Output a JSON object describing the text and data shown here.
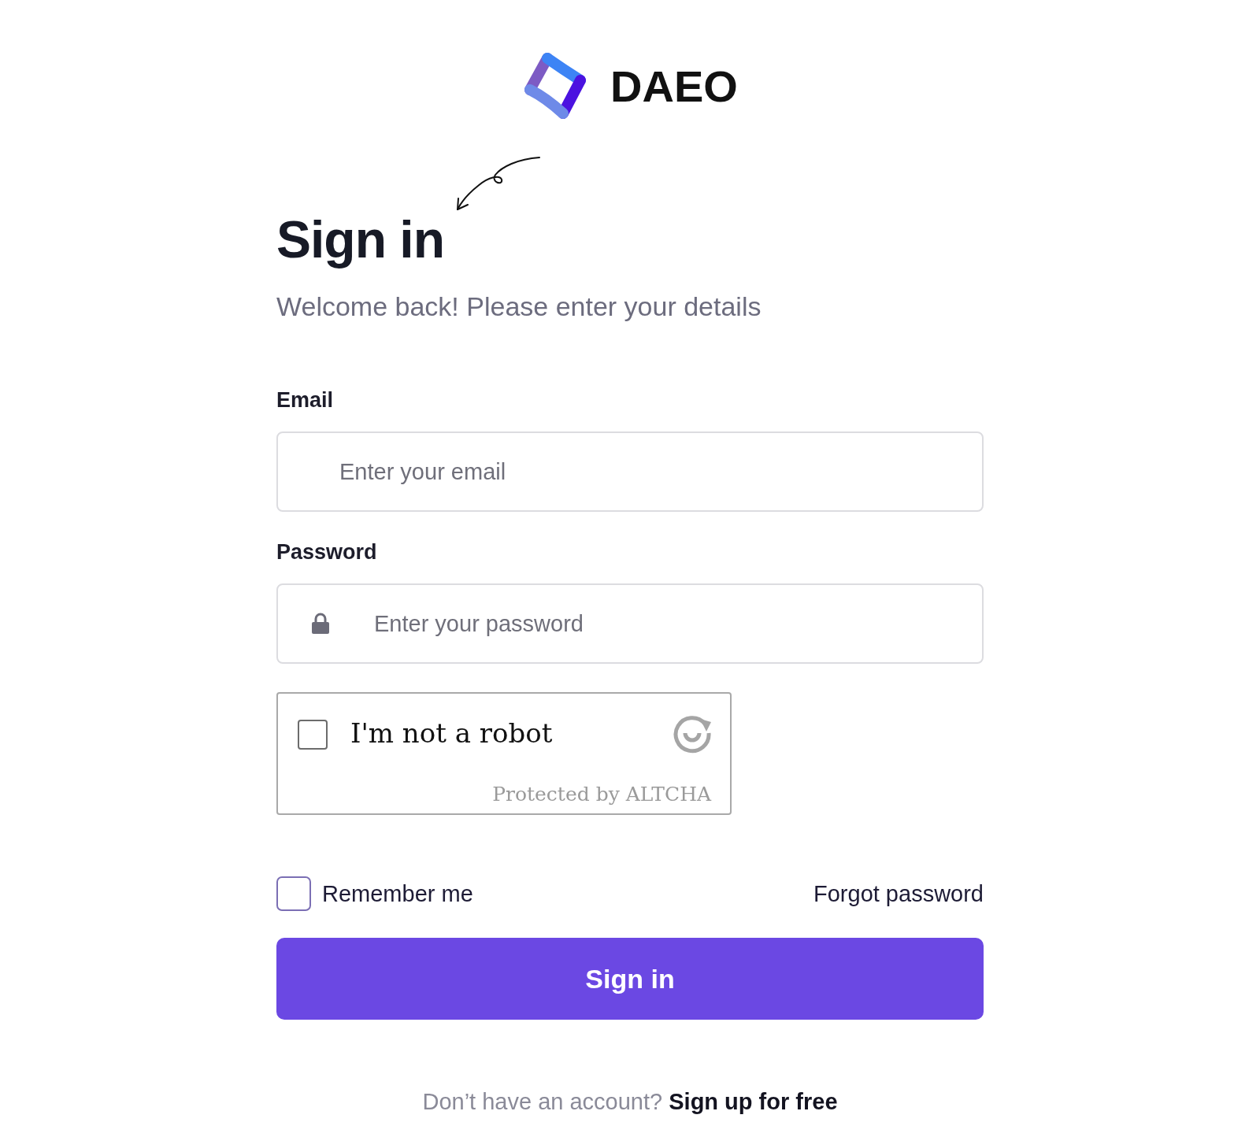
{
  "brand": {
    "name": "DAEO"
  },
  "heading": "Sign in",
  "subtitle": "Welcome back! Please enter your details",
  "fields": [
    {
      "kind": "email",
      "label": "Email",
      "placeholder": "Enter your email"
    },
    {
      "kind": "password",
      "label": "Password",
      "placeholder": "Enter your password"
    }
  ],
  "captcha": {
    "label": "I'm not a robot",
    "checked": false,
    "footer": "Protected by ALTCHA"
  },
  "remember": {
    "label": "Remember me",
    "checked": false
  },
  "forgot_link": "Forgot password",
  "submit_button": "Sign in",
  "footer": {
    "prompt": "Don’t have an account?",
    "link": "Sign up for free"
  }
}
